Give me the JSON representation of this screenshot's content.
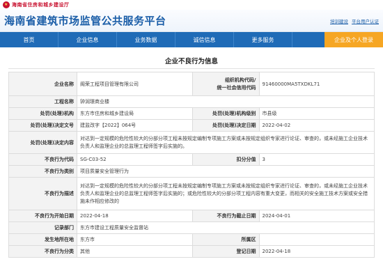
{
  "gov_header": {
    "org": "海南省住房和城乡建设厅"
  },
  "site": {
    "title": "海南省建筑市场监管公共服务平台",
    "links": [
      "培训建设",
      "平台用户认证"
    ]
  },
  "nav": {
    "items": [
      "首页",
      "企业信息",
      "业务数据",
      "诚信信息",
      "更多服务"
    ],
    "cta": "企业及个人登录"
  },
  "page": {
    "title": "企业不良行为信息"
  },
  "record": {
    "enterprise_label": "企业名称",
    "enterprise": "阁荣工程项目管理有限公司",
    "org_code_label_1": "组织机构代码/",
    "org_code_label_2": "统一社会信用代码",
    "org_code": "91460000MA5TXDKL71",
    "project_label": "工程名称",
    "project": "钟润璟商业楼",
    "authority_label": "处罚(处理)机构",
    "authority": "东方市住房和城乡建设局",
    "authority_level_label": "处罚(处理)机构级别",
    "authority_level": "市县级",
    "doc_no_label": "处罚(处理)决定文号",
    "doc_no": "建监改字【2022】064号",
    "decision_date_label": "处罚(处理)决定日期",
    "decision_date": "2022-04-02",
    "content_label": "处罚(处理)决定内容",
    "content": "对达到一定规模的危险性较大的分部分项工程未按规定编制专项施工方案或未按规定组织专家进行论证、审查的，或未经施工企业技术负责人和监理企业的总监理工程师签字后实施的。",
    "code_label": "不良行为代码",
    "code": "SG-C03-52",
    "score_label": "扣分分值",
    "score": "3",
    "category_label": "不良行为类别",
    "category": "项目质量安全管理行为",
    "desc_label": "不良行为描述",
    "desc": "对达到一定规模的危险性较大的分部分项工程未按规定编制专项施工方案或未按规定组织专家进行论证、审查的，或未经施工企业技术负责人和监理企业的总监理工程师签字后实施的；或危险性较大的分部分项工程内容有重大变更，而相关的安全施工技术方案或安全措施未作相应修改的",
    "start_label": "不良行为开始日期",
    "start": "2022-04-18",
    "end_label": "不良行为截止日期",
    "end": "2024-04-01",
    "recorder_label": "记录部门",
    "recorder": "东方市建设工程质量安全监督站",
    "place_label": "发生地所在地",
    "place": "东方市",
    "region_label": "所属区",
    "region": "",
    "other_label": "不良行为分类",
    "other": "其他",
    "register_label": "登记日期",
    "register": "2022-04-18"
  }
}
